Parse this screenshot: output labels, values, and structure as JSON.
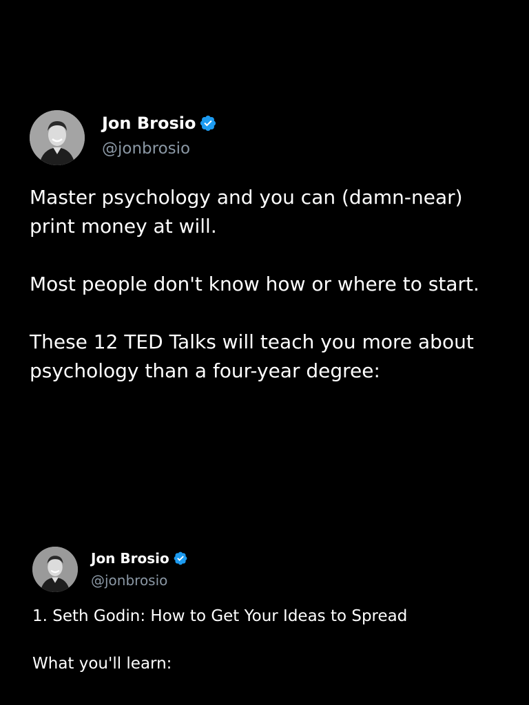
{
  "tweet_main": {
    "display_name": "Jon Brosio",
    "handle": "@jonbrosio",
    "paragraphs": [
      "Master psychology and you can (damn-near) print money at will.",
      "Most people don't know how or where to start.",
      "These 12 TED Talks will teach you more about psychology than a four-year degree:"
    ],
    "verified_icon": "verified-badge-icon",
    "verified_color": "#1d9bf0"
  },
  "tweet_reply": {
    "display_name": "Jon Brosio",
    "handle": "@jonbrosio",
    "paragraphs": [
      "1. Seth Godin: How to Get Your Ideas to Spread",
      "What you'll learn:"
    ],
    "verified_icon": "verified-badge-icon",
    "verified_color": "#1d9bf0"
  },
  "colors": {
    "background": "#000000",
    "text_primary": "#ffffff",
    "text_secondary": "#8b98a5",
    "accent": "#1d9bf0"
  }
}
